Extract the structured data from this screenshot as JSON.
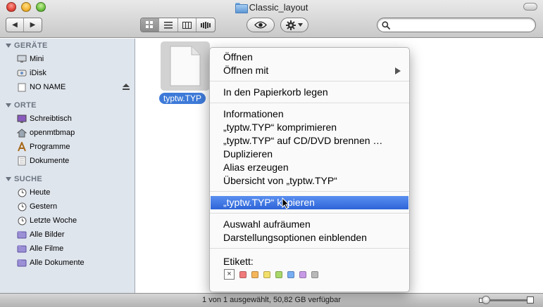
{
  "window": {
    "title": "Classic_layout"
  },
  "toolbar": {
    "back_icon": "◀",
    "forward_icon": "▶",
    "search_placeholder": "",
    "search_value": ""
  },
  "sidebar": {
    "sections": [
      {
        "title": "GERÄTE"
      },
      {
        "title": "ORTE"
      },
      {
        "title": "SUCHE"
      }
    ],
    "devices": [
      "Mini",
      "iDisk",
      "NO NAME"
    ],
    "places": [
      "Schreibtisch",
      "openmtbmap",
      "Programme",
      "Dokumente"
    ],
    "searches": [
      "Heute",
      "Gestern",
      "Letzte Woche",
      "Alle Bilder",
      "Alle Filme",
      "Alle Dokumente"
    ]
  },
  "content": {
    "file_name": "typtw.TYP"
  },
  "context_menu": {
    "items": [
      "Öffnen",
      "Öffnen mit",
      "In den Papierkorb legen",
      "Informationen",
      "„typtw.TYP“ komprimieren",
      "„typtw.TYP“ auf CD/DVD brennen …",
      "Duplizieren",
      "Alias erzeugen",
      "Übersicht von „typtw.TYP“",
      "„typtw.TYP“ kopieren",
      "Auswahl aufräumen",
      "Darstellungsoptionen einblenden"
    ],
    "highlighted_index": 9,
    "label_heading": "Etikett:",
    "label_none": "×",
    "label_colors": [
      "#f07a7a",
      "#f5b65a",
      "#f2df6b",
      "#a9d86a",
      "#79aef2",
      "#c79ae6",
      "#b9b9b9"
    ]
  },
  "statusbar": {
    "text": "1 von 1 ausgewählt, 50,82 GB verfügbar"
  }
}
